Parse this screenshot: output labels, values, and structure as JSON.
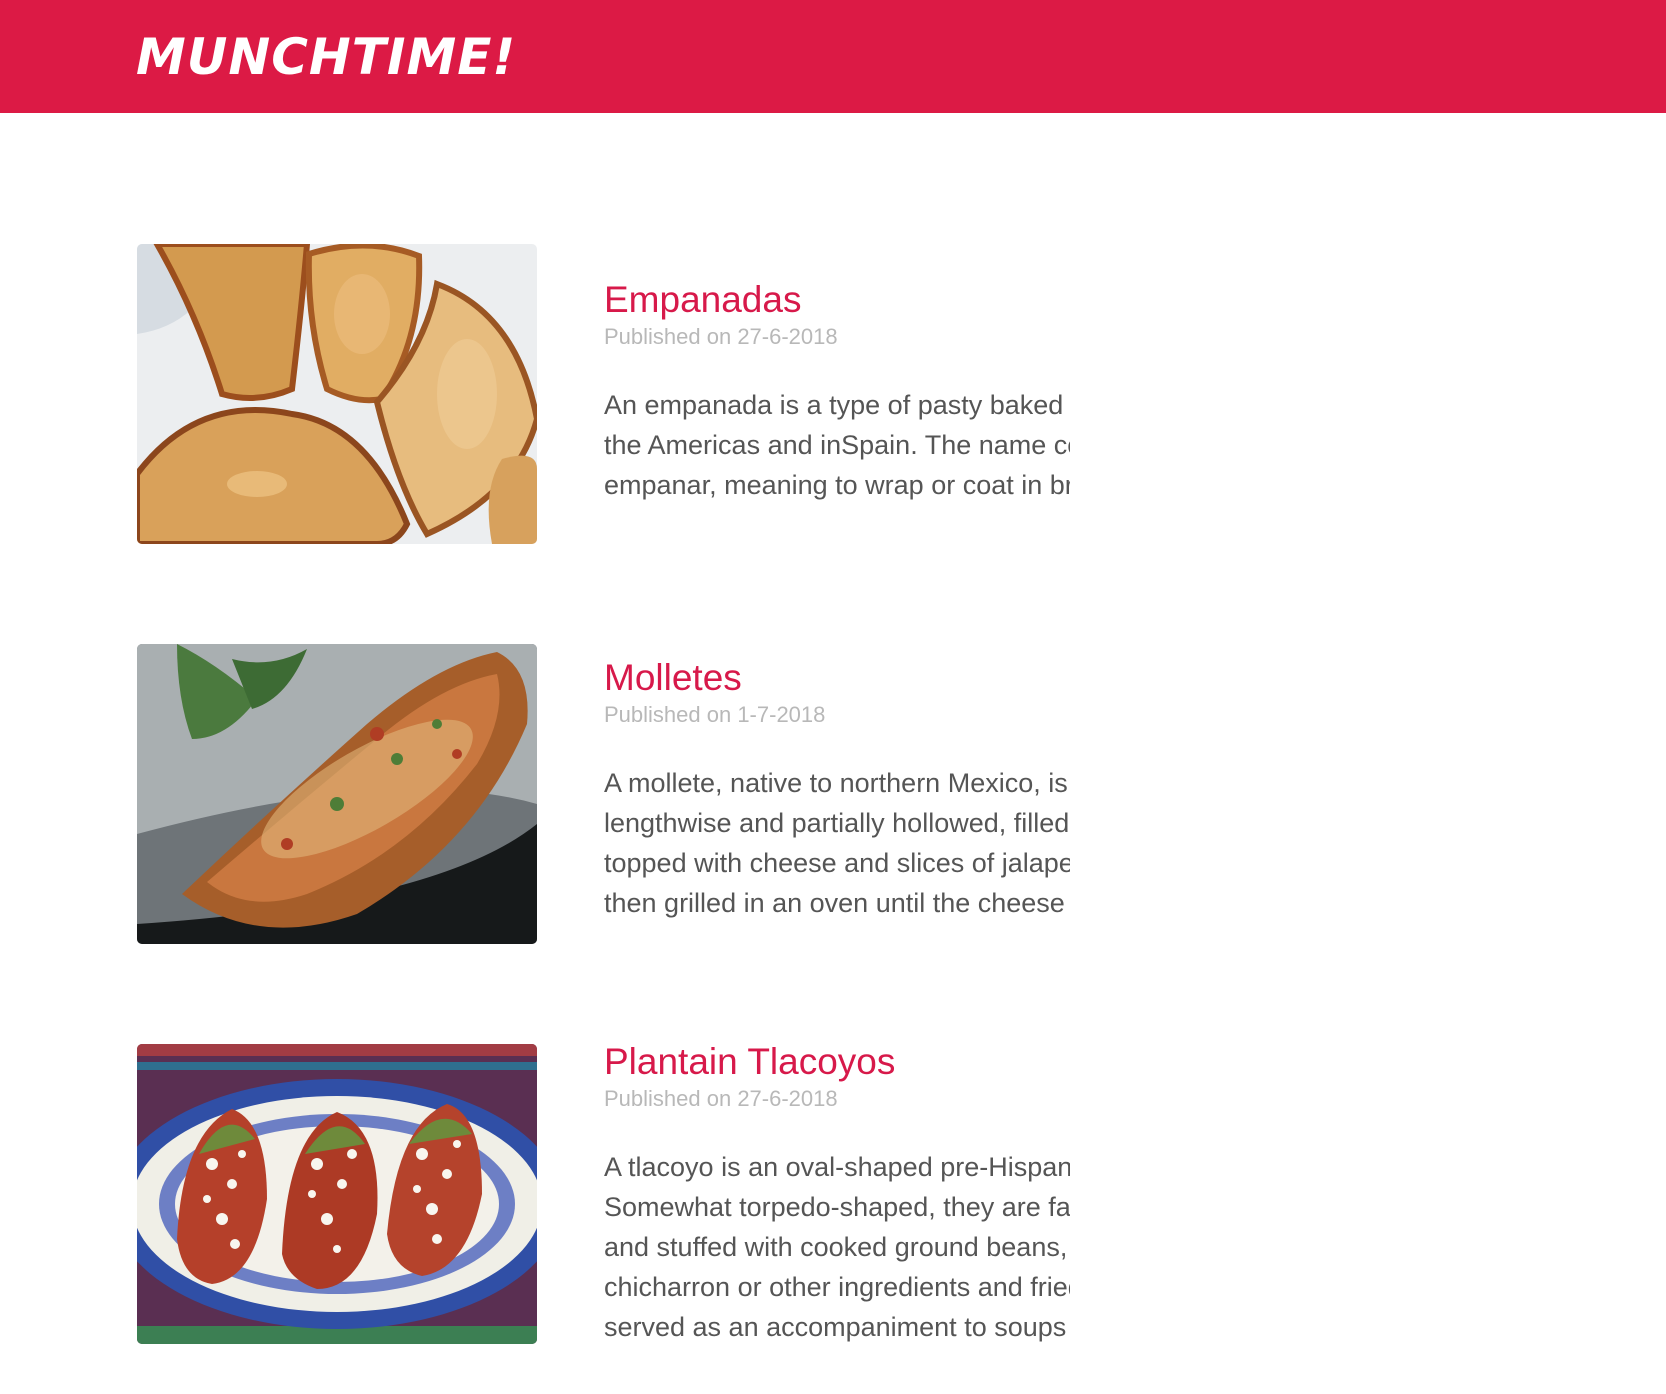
{
  "app": {
    "brand": "Munchtime!",
    "brand_color": "#dc1a45"
  },
  "posts": [
    {
      "title": "Empanadas",
      "date": "Published on 27-6-2018",
      "image_icon": "empanadas-photo-icon",
      "excerpt_lines": [
        "An empanada is a type of pasty baked or fried in many countries of",
        "the Americas and inSpain. The name comes from the Spanish verb",
        "empanar, meaning to wrap or coat in bread...."
      ]
    },
    {
      "title": "Molletes",
      "date": "Published on 1-7-2018",
      "image_icon": "molletes-photo-icon",
      "excerpt_lines": [
        "A mollete, native to northern Mexico, is made with bolillos sliced",
        "lengthwise and partially hollowed, filled with frijoles refritos, and",
        "topped with cheese and slices of jalapeño or serrano peppers. It is",
        "then grilled in an oven until the cheese melts...."
      ]
    },
    {
      "title": "Plantain Tlacoyos",
      "date": "Published on 27-6-2018",
      "image_icon": "tlacoyos-photo-icon",
      "excerpt_lines": [
        "A tlacoyo is an oval-shaped pre-Hispanic Mexican dish made of ma",
        "Somewhat torpedo-shaped, they are fatter than fresh corn tortillas",
        "and stuffed with cooked ground beans, cheese, fava beans,",
        "chicharron or other ingredients and fried or toasted. Tlacoyos can b",
        "served as an accompaniment to soups a..."
      ]
    }
  ]
}
